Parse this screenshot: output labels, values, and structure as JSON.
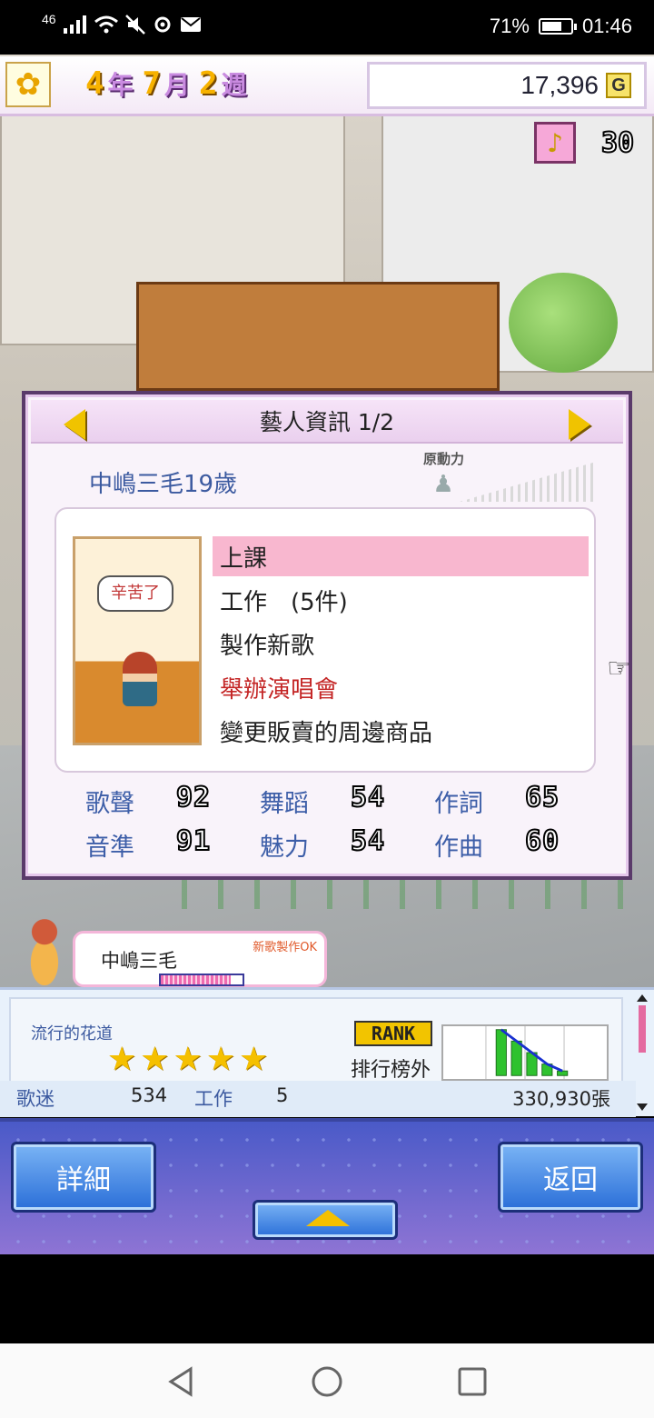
{
  "statusbar": {
    "signal": "46",
    "battery_text": "71%",
    "battery_level": 0.71,
    "time": "01:46"
  },
  "hud": {
    "date": {
      "year": "4",
      "year_unit": "年",
      "month": "7",
      "month_unit": "月",
      "week": "2",
      "week_unit": "週"
    },
    "money": "17,396",
    "currency_badge": "G",
    "trophy_count": "30"
  },
  "panel": {
    "title": "藝人資訊 1/2",
    "artist_name": "中嶋三毛19歲",
    "motivation_label": "原動力",
    "speech_bubble": "辛苦了",
    "options": [
      {
        "label": "上課",
        "selected": true
      },
      {
        "label": "工作　(5件)"
      },
      {
        "label": "製作新歌"
      },
      {
        "label": "舉辦演唱會",
        "highlight": true
      },
      {
        "label": "變更販賣的周邊商品"
      }
    ],
    "stats": [
      {
        "label": "歌聲",
        "value": "92"
      },
      {
        "label": "舞蹈",
        "value": "54"
      },
      {
        "label": "作詞",
        "value": "65"
      },
      {
        "label": "音準",
        "value": "91"
      },
      {
        "label": "魅力",
        "value": "54"
      },
      {
        "label": "作曲",
        "value": "60"
      }
    ]
  },
  "artist_strip": {
    "name": "中嶋三毛",
    "tag": "新歌製作OK",
    "progress": 0.85
  },
  "info": {
    "trend_name": "流行的花道",
    "stars": 5,
    "rank_badge": "RANK",
    "rank_text": "排行榜外",
    "rank_bars": [
      4,
      3,
      2,
      1,
      0.4
    ],
    "fans_label": "歌迷",
    "fans": "534",
    "jobs_label": "工作",
    "jobs": "5",
    "sales": "330,930張"
  },
  "buttons": {
    "detail": "詳細",
    "back": "返回"
  },
  "colors": {
    "accent_blue": "#3c5aa0",
    "selected_row": "#f8b7cf",
    "highlight_red": "#c42626",
    "panel_border": "#5a3a6a"
  }
}
